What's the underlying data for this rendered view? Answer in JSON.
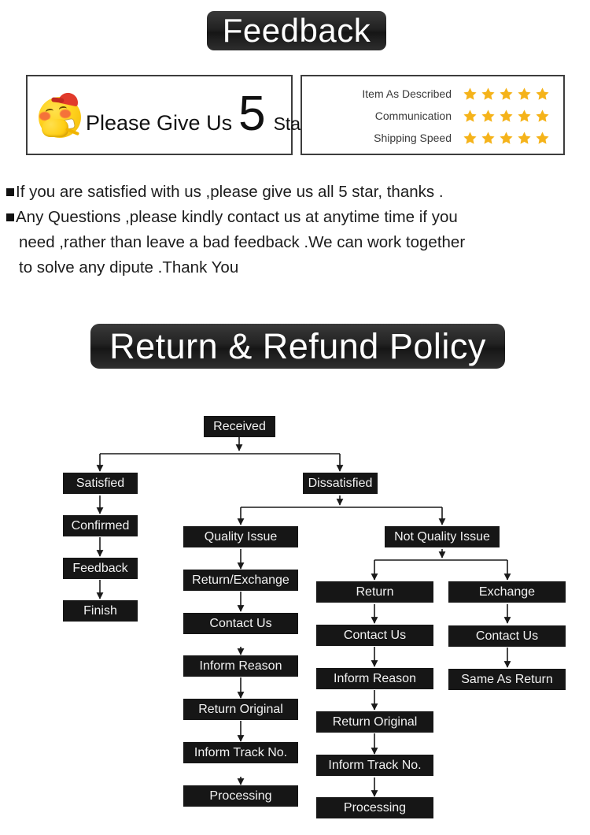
{
  "feedback": {
    "banner_title": "Feedback",
    "give_star": {
      "prefix": "Please Give Us",
      "number": "5",
      "suffix": "Star",
      "emoji_name": "shy-smiley-emoji"
    },
    "ratings": [
      {
        "label": "Item As Described",
        "stars": 5
      },
      {
        "label": "Communication",
        "stars": 5
      },
      {
        "label": "Shipping Speed",
        "stars": 5
      }
    ],
    "star_color": "#F5B31A",
    "notes": [
      {
        "bullet": true,
        "text": "If you are satisfied with us ,please give us all 5 star, thanks ."
      },
      {
        "bullet": true,
        "text": "Any Questions ,please kindly contact us at anytime time if you"
      },
      {
        "bullet": false,
        "text": "need ,rather than leave a bad feedback .We can work together"
      },
      {
        "bullet": false,
        "text": "to solve any dipute .Thank You"
      }
    ]
  },
  "policy": {
    "banner_title": "Return & Refund Policy",
    "nodes": {
      "received": "Received",
      "satisfied": "Satisfied",
      "confirmed": "Confirmed",
      "feedback": "Feedback",
      "finish": "Finish",
      "dissatisfied": "Dissatisfied",
      "quality_issue": "Quality Issue",
      "return_exchange": "Return/Exchange",
      "contact_us_mid": "Contact Us",
      "inform_reason_mid": "Inform Reason",
      "return_original_mid": "Return Original",
      "inform_track_mid": "Inform Track No.",
      "processing_mid": "Processing",
      "not_quality_issue": "Not Quality Issue",
      "return": "Return",
      "contact_us_return": "Contact Us",
      "inform_reason_return": "Inform Reason",
      "return_original_return": "Return Original",
      "inform_track_return": "Inform Track No.",
      "processing_return": "Processing",
      "exchange": "Exchange",
      "contact_us_exchange": "Contact Us",
      "same_as_return": "Same As Return"
    }
  },
  "colors": {
    "node_fill": "#161616",
    "node_text": "#F2F2F2",
    "banner_fill": "#222222",
    "panel_border": "#3D3D3D",
    "star": "#F5B31A"
  }
}
